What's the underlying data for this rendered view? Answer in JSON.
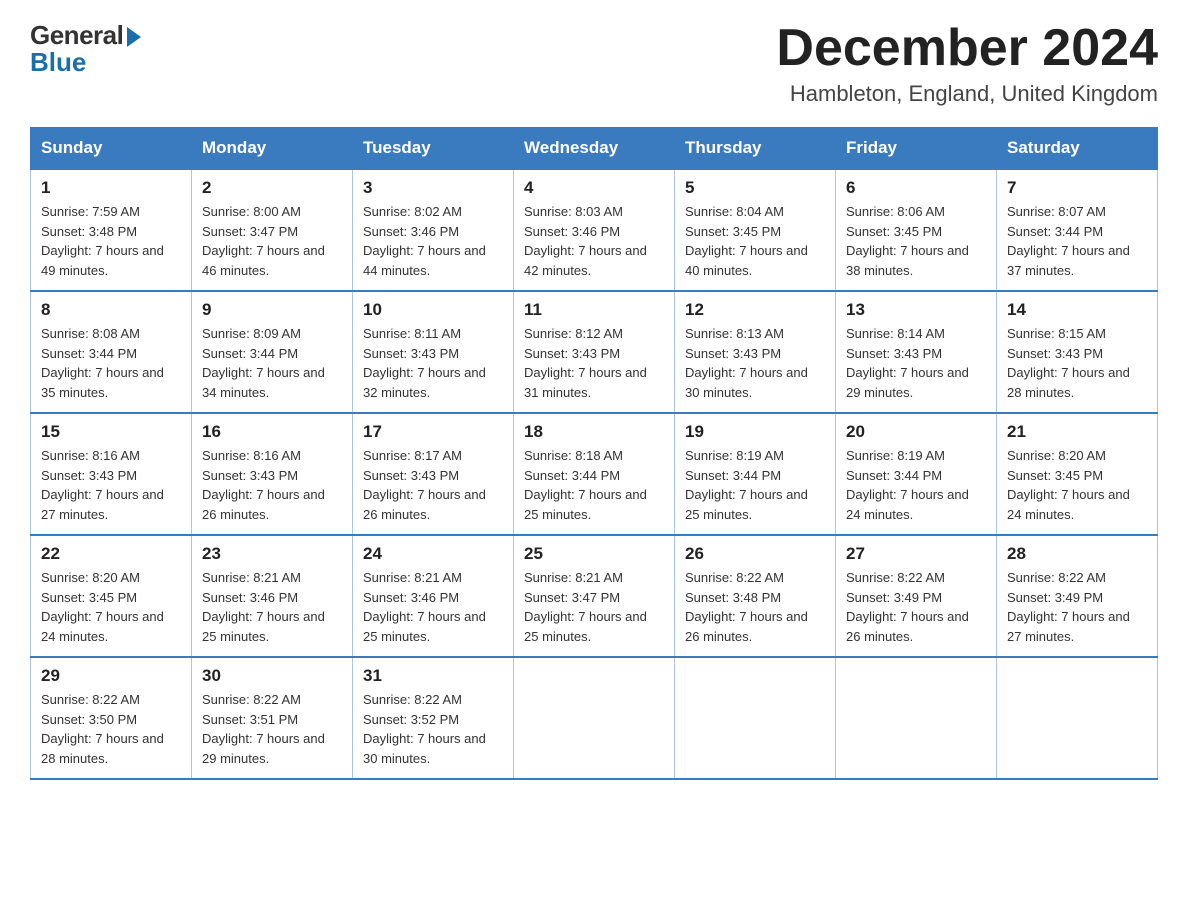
{
  "logo": {
    "general": "General",
    "blue": "Blue"
  },
  "header": {
    "month": "December 2024",
    "location": "Hambleton, England, United Kingdom"
  },
  "weekdays": [
    "Sunday",
    "Monday",
    "Tuesday",
    "Wednesday",
    "Thursday",
    "Friday",
    "Saturday"
  ],
  "weeks": [
    [
      {
        "day": "1",
        "sunrise": "7:59 AM",
        "sunset": "3:48 PM",
        "daylight": "7 hours and 49 minutes."
      },
      {
        "day": "2",
        "sunrise": "8:00 AM",
        "sunset": "3:47 PM",
        "daylight": "7 hours and 46 minutes."
      },
      {
        "day": "3",
        "sunrise": "8:02 AM",
        "sunset": "3:46 PM",
        "daylight": "7 hours and 44 minutes."
      },
      {
        "day": "4",
        "sunrise": "8:03 AM",
        "sunset": "3:46 PM",
        "daylight": "7 hours and 42 minutes."
      },
      {
        "day": "5",
        "sunrise": "8:04 AM",
        "sunset": "3:45 PM",
        "daylight": "7 hours and 40 minutes."
      },
      {
        "day": "6",
        "sunrise": "8:06 AM",
        "sunset": "3:45 PM",
        "daylight": "7 hours and 38 minutes."
      },
      {
        "day": "7",
        "sunrise": "8:07 AM",
        "sunset": "3:44 PM",
        "daylight": "7 hours and 37 minutes."
      }
    ],
    [
      {
        "day": "8",
        "sunrise": "8:08 AM",
        "sunset": "3:44 PM",
        "daylight": "7 hours and 35 minutes."
      },
      {
        "day": "9",
        "sunrise": "8:09 AM",
        "sunset": "3:44 PM",
        "daylight": "7 hours and 34 minutes."
      },
      {
        "day": "10",
        "sunrise": "8:11 AM",
        "sunset": "3:43 PM",
        "daylight": "7 hours and 32 minutes."
      },
      {
        "day": "11",
        "sunrise": "8:12 AM",
        "sunset": "3:43 PM",
        "daylight": "7 hours and 31 minutes."
      },
      {
        "day": "12",
        "sunrise": "8:13 AM",
        "sunset": "3:43 PM",
        "daylight": "7 hours and 30 minutes."
      },
      {
        "day": "13",
        "sunrise": "8:14 AM",
        "sunset": "3:43 PM",
        "daylight": "7 hours and 29 minutes."
      },
      {
        "day": "14",
        "sunrise": "8:15 AM",
        "sunset": "3:43 PM",
        "daylight": "7 hours and 28 minutes."
      }
    ],
    [
      {
        "day": "15",
        "sunrise": "8:16 AM",
        "sunset": "3:43 PM",
        "daylight": "7 hours and 27 minutes."
      },
      {
        "day": "16",
        "sunrise": "8:16 AM",
        "sunset": "3:43 PM",
        "daylight": "7 hours and 26 minutes."
      },
      {
        "day": "17",
        "sunrise": "8:17 AM",
        "sunset": "3:43 PM",
        "daylight": "7 hours and 26 minutes."
      },
      {
        "day": "18",
        "sunrise": "8:18 AM",
        "sunset": "3:44 PM",
        "daylight": "7 hours and 25 minutes."
      },
      {
        "day": "19",
        "sunrise": "8:19 AM",
        "sunset": "3:44 PM",
        "daylight": "7 hours and 25 minutes."
      },
      {
        "day": "20",
        "sunrise": "8:19 AM",
        "sunset": "3:44 PM",
        "daylight": "7 hours and 24 minutes."
      },
      {
        "day": "21",
        "sunrise": "8:20 AM",
        "sunset": "3:45 PM",
        "daylight": "7 hours and 24 minutes."
      }
    ],
    [
      {
        "day": "22",
        "sunrise": "8:20 AM",
        "sunset": "3:45 PM",
        "daylight": "7 hours and 24 minutes."
      },
      {
        "day": "23",
        "sunrise": "8:21 AM",
        "sunset": "3:46 PM",
        "daylight": "7 hours and 25 minutes."
      },
      {
        "day": "24",
        "sunrise": "8:21 AM",
        "sunset": "3:46 PM",
        "daylight": "7 hours and 25 minutes."
      },
      {
        "day": "25",
        "sunrise": "8:21 AM",
        "sunset": "3:47 PM",
        "daylight": "7 hours and 25 minutes."
      },
      {
        "day": "26",
        "sunrise": "8:22 AM",
        "sunset": "3:48 PM",
        "daylight": "7 hours and 26 minutes."
      },
      {
        "day": "27",
        "sunrise": "8:22 AM",
        "sunset": "3:49 PM",
        "daylight": "7 hours and 26 minutes."
      },
      {
        "day": "28",
        "sunrise": "8:22 AM",
        "sunset": "3:49 PM",
        "daylight": "7 hours and 27 minutes."
      }
    ],
    [
      {
        "day": "29",
        "sunrise": "8:22 AM",
        "sunset": "3:50 PM",
        "daylight": "7 hours and 28 minutes."
      },
      {
        "day": "30",
        "sunrise": "8:22 AM",
        "sunset": "3:51 PM",
        "daylight": "7 hours and 29 minutes."
      },
      {
        "day": "31",
        "sunrise": "8:22 AM",
        "sunset": "3:52 PM",
        "daylight": "7 hours and 30 minutes."
      },
      null,
      null,
      null,
      null
    ]
  ]
}
